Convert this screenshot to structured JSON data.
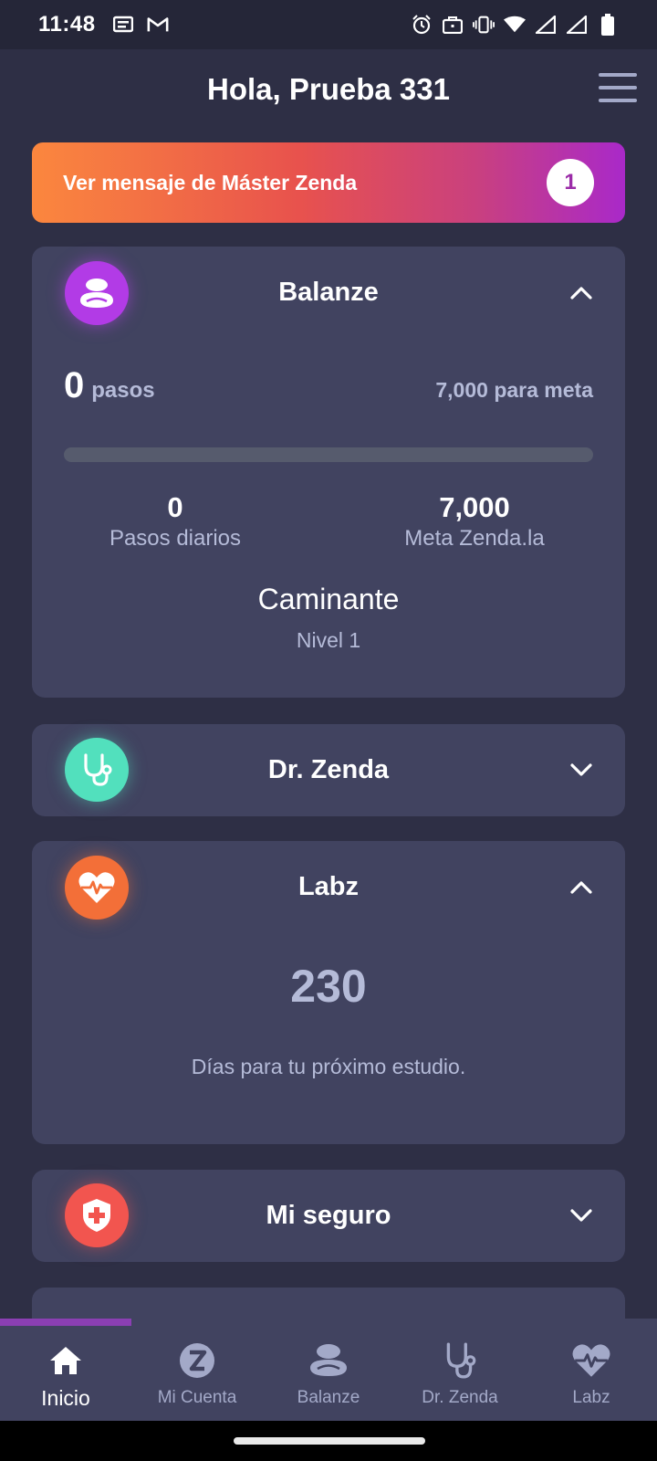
{
  "status_bar": {
    "time": "11:48",
    "left_icons": [
      "notification-icon",
      "gmail-icon"
    ],
    "right_icons": [
      "alarm-icon",
      "briefcase-icon",
      "vibrate-icon",
      "wifi-icon",
      "signal-icon",
      "signal-icon",
      "battery-icon"
    ]
  },
  "header": {
    "title": "Hola, Prueba 331",
    "menu_icon": "hamburger-menu-icon"
  },
  "banner": {
    "text": "Ver mensaje de Máster Zenda",
    "badge": "1"
  },
  "balanze": {
    "title": "Balanze",
    "steps_value": "0",
    "steps_unit": "pasos",
    "goal_text": "7,000 para meta",
    "progress": 0,
    "daily_steps_value": "0",
    "daily_steps_label": "Pasos diarios",
    "goal_value": "7,000",
    "goal_label": "Meta Zenda.la",
    "level_title": "Caminante",
    "level_sub": "Nivel 1",
    "expanded": true
  },
  "dr_zenda": {
    "title": "Dr. Zenda",
    "expanded": false
  },
  "labz": {
    "title": "Labz",
    "days_value": "230",
    "days_label": "Días para tu próximo estudio.",
    "expanded": true
  },
  "seguro": {
    "title": "Mi seguro",
    "expanded": false
  },
  "nav": {
    "items": [
      {
        "label": "Inicio",
        "icon": "home-icon",
        "active": true
      },
      {
        "label": "Mi Cuenta",
        "icon": "zenda-z-icon",
        "active": false
      },
      {
        "label": "Balanze",
        "icon": "balanze-stones-icon",
        "active": false
      },
      {
        "label": "Dr. Zenda",
        "icon": "stethoscope-icon",
        "active": false
      },
      {
        "label": "Labz",
        "icon": "heart-pulse-icon",
        "active": false
      }
    ]
  },
  "colors": {
    "background": "#2e2f45",
    "card": "#414360",
    "accent_purple": "#b23be6",
    "accent_teal": "#52e0bd",
    "accent_orange": "#f36f38",
    "accent_red": "#f2554f",
    "nav_indicator": "#8b3fb3"
  }
}
